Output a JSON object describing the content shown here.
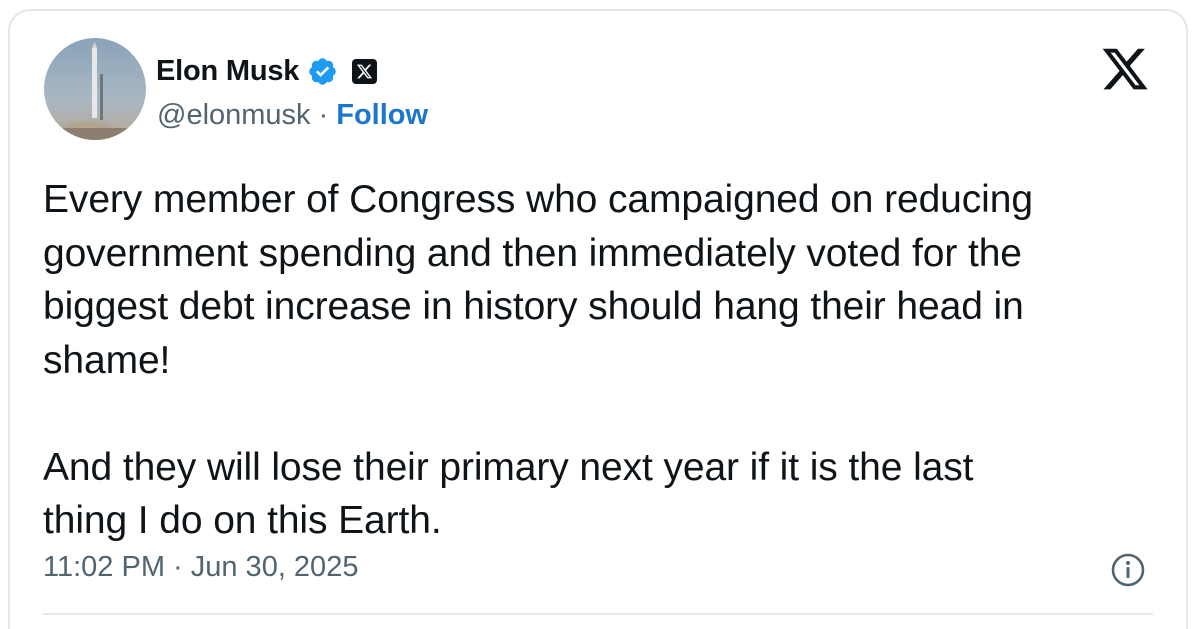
{
  "author": {
    "display_name": "Elon Musk",
    "handle": "@elonmusk",
    "separator": "·",
    "follow_label": "Follow",
    "verified": true,
    "affiliation_badge": "x-logo-badge"
  },
  "tweet": {
    "paragraphs": [
      "Every member of Congress who campaigned on reducing\ngovernment spending and then immediately voted for the\nbiggest debt increase in history should hang their head in\nshame!",
      "And they will lose their primary next year if it is the last\nthing I do on this Earth."
    ],
    "timestamp": "11:02 PM · Jun 30, 2025"
  },
  "icons": {
    "platform_logo": "x-logo-icon",
    "info": "info-icon",
    "verified": "verified-badge-icon"
  },
  "colors": {
    "text": "#0f1419",
    "secondary": "#536471",
    "link": "#1d77c9",
    "verified": "#1d9bf0"
  }
}
